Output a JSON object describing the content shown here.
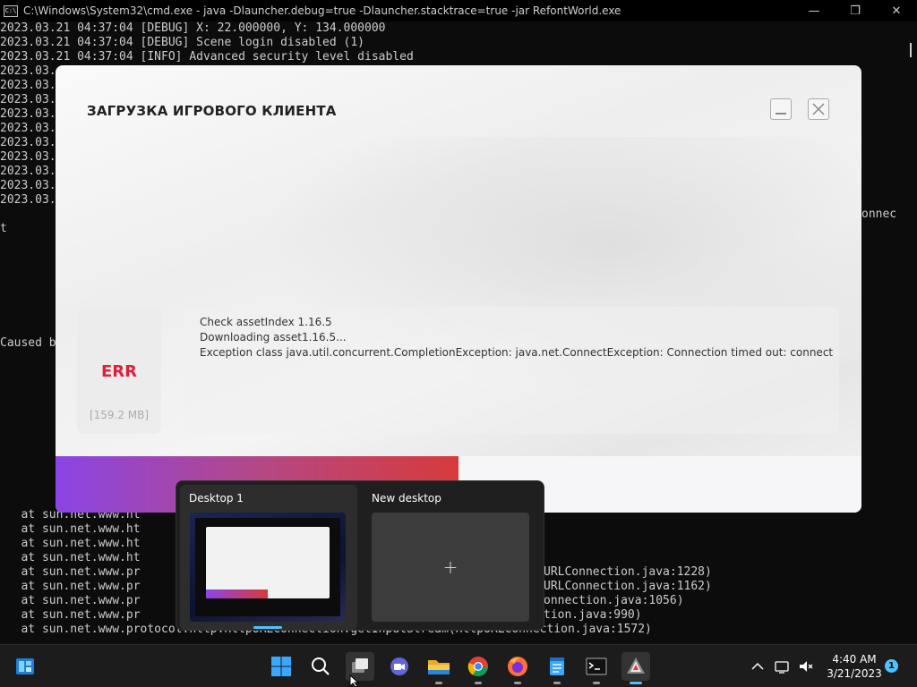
{
  "cmd": {
    "title": "C:\\Windows\\System32\\cmd.exe - java  -Dlauncher.debug=true -Dlauncher.stacktrace=true -jar RefontWorld.exe",
    "icon_text": "C:\\",
    "controls": {
      "minimize": "—",
      "maximize": "❐",
      "close": "✕"
    },
    "lines_top": [
      "2023.03.21 04:37:04 [DEBUG] X: 22.000000, Y: 134.000000",
      "2023.03.21 04:37:04 [DEBUG] Scene login disabled (1)",
      "2023.03.21 04:37:04 [INFO] Advanced security level disabled",
      "2023.03.",
      "2023.03.",
      "2023.03.",
      "2023.03.",
      "2023.03.",
      "2023.03.",
      "2023.03.",
      "2023.03.",
      "2023.03.",
      "2023.03."
    ],
    "line_t": "t",
    "line_connec": "onnec",
    "line_caused": "Caused b",
    "lines_bottom_left": [
      "   at sun.net.www.ht",
      "   at sun.net.www.ht",
      "   at sun.net.www.ht",
      "   at sun.net.www.ht",
      "   at sun.net.www.pr",
      "   at sun.net.www.pr",
      "   at sun.net.www.pr",
      "   at sun.net.www.pr"
    ],
    "lines_bottom_right": [
      "URLConnection.java:1228)",
      "URLConnection.java:1162)",
      "onnection.java:1056)",
      "tion.java:990)"
    ],
    "last_line": "   at sun.net.www.protocol.http.HttpURLConnection.getInputStream(HttpURLConnection.java:1572)"
  },
  "launcher": {
    "title": "ЗАГРУЗКА ИГРОВОГО КЛИЕНТА",
    "status": "ERR",
    "size": "[159.2 MB]",
    "log": [
      "Check assetIndex 1.16.5",
      "Downloading asset1.16.5...",
      "Exception class java.util.concurrent.CompletionException: java.net.ConnectException: Connection timed out: connect"
    ],
    "progress_fraction": 0.5
  },
  "taskview": {
    "desktop1_label": "Desktop 1",
    "new_desktop_label": "New desktop",
    "new_desktop_plus": "+"
  },
  "taskbar": {
    "time": "4:40 AM",
    "date": "3/21/2023",
    "notification_count": "1"
  }
}
